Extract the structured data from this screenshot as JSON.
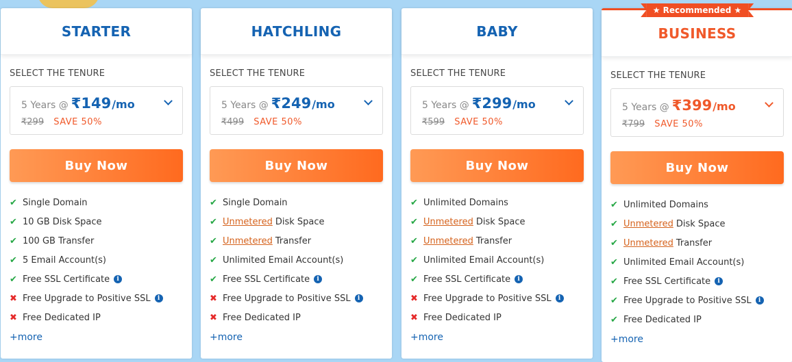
{
  "colors": {
    "primary": "#1563b2",
    "accent": "#f0592a",
    "check": "#26a745",
    "cross": "#e52a2a"
  },
  "plans": [
    {
      "name": "STARTER",
      "tenure_label": "SELECT THE TENURE",
      "tenure_years": "5 Years @",
      "price": "₹149",
      "per": "/mo",
      "old_price": "₹299",
      "save": "SAVE 50%",
      "buy_label": "Buy Now",
      "more": "+more",
      "features": [
        {
          "icon": "check-icon",
          "prefix": "",
          "text": "Single Domain"
        },
        {
          "icon": "check-icon",
          "prefix": "",
          "text": "10 GB Disk Space"
        },
        {
          "icon": "check-icon",
          "prefix": "",
          "text": "100 GB Transfer"
        },
        {
          "icon": "check-icon",
          "prefix": "",
          "text": "5 Email Account(s)"
        },
        {
          "icon": "check-icon",
          "prefix": "",
          "text": "Free SSL Certificate"
        },
        {
          "icon": "cross-icon",
          "prefix": "",
          "text": "Free Upgrade to Positive SSL"
        },
        {
          "icon": "cross-icon",
          "prefix": "",
          "text": "Free Dedicated IP"
        }
      ]
    },
    {
      "name": "HATCHLING",
      "tenure_label": "SELECT THE TENURE",
      "tenure_years": "5 Years @",
      "price": "₹249",
      "per": "/mo",
      "old_price": "₹499",
      "save": "SAVE 50%",
      "buy_label": "Buy Now",
      "more": "+more",
      "features": [
        {
          "icon": "check-icon",
          "prefix": "",
          "text": "Single Domain"
        },
        {
          "icon": "check-icon",
          "prefix": "Unmetered",
          "text": "Disk Space"
        },
        {
          "icon": "check-icon",
          "prefix": "Unmetered",
          "text": "Transfer"
        },
        {
          "icon": "check-icon",
          "prefix": "",
          "text": "Unlimited Email Account(s)"
        },
        {
          "icon": "check-icon",
          "prefix": "",
          "text": "Free SSL Certificate"
        },
        {
          "icon": "cross-icon",
          "prefix": "",
          "text": "Free Upgrade to Positive SSL"
        },
        {
          "icon": "cross-icon",
          "prefix": "",
          "text": "Free Dedicated IP"
        }
      ]
    },
    {
      "name": "BABY",
      "tenure_label": "SELECT THE TENURE",
      "tenure_years": "5 Years @",
      "price": "₹299",
      "per": "/mo",
      "old_price": "₹599",
      "save": "SAVE 50%",
      "buy_label": "Buy Now",
      "more": "+more",
      "features": [
        {
          "icon": "check-icon",
          "prefix": "",
          "text": "Unlimited Domains"
        },
        {
          "icon": "check-icon",
          "prefix": "Unmetered",
          "text": "Disk Space"
        },
        {
          "icon": "check-icon",
          "prefix": "Unmetered",
          "text": "Transfer"
        },
        {
          "icon": "check-icon",
          "prefix": "",
          "text": "Unlimited Email Account(s)"
        },
        {
          "icon": "check-icon",
          "prefix": "",
          "text": "Free SSL Certificate"
        },
        {
          "icon": "cross-icon",
          "prefix": "",
          "text": "Free Upgrade to Positive SSL"
        },
        {
          "icon": "cross-icon",
          "prefix": "",
          "text": "Free Dedicated IP"
        }
      ]
    },
    {
      "name": "BUSINESS",
      "badge": "★ Recommended ★",
      "tenure_label": "SELECT THE TENURE",
      "tenure_years": "5 Years @",
      "price": "₹399",
      "per": "/mo",
      "old_price": "₹799",
      "save": "SAVE 50%",
      "buy_label": "Buy Now",
      "more": "+more",
      "features": [
        {
          "icon": "check-icon",
          "prefix": "",
          "text": "Unlimited Domains"
        },
        {
          "icon": "check-icon",
          "prefix": "Unmetered",
          "text": "Disk Space"
        },
        {
          "icon": "check-icon",
          "prefix": "Unmetered",
          "text": "Transfer"
        },
        {
          "icon": "check-icon",
          "prefix": "",
          "text": "Unlimited Email Account(s)"
        },
        {
          "icon": "check-icon",
          "prefix": "",
          "text": "Free SSL Certificate"
        },
        {
          "icon": "check-icon",
          "prefix": "",
          "text": "Free Upgrade to Positive SSL"
        },
        {
          "icon": "check-icon",
          "prefix": "",
          "text": "Free Dedicated IP"
        }
      ]
    }
  ]
}
